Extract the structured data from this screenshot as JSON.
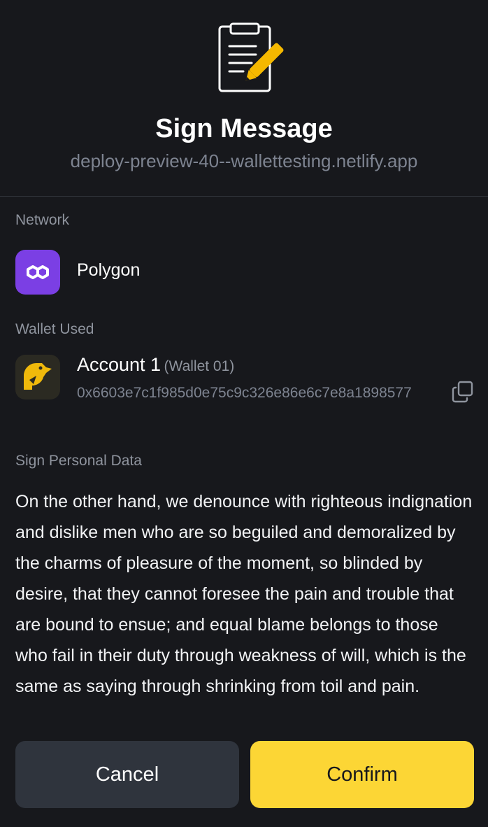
{
  "header": {
    "title": "Sign Message",
    "origin": "deploy-preview-40--wallettesting.netlify.app",
    "icon": "document-sign-icon"
  },
  "network": {
    "label": "Network",
    "name": "Polygon",
    "icon": "polygon-logo-icon",
    "color": "#7b3fe4"
  },
  "wallet": {
    "label": "Wallet Used",
    "account_name": "Account 1",
    "wallet_name": "(Wallet 01)",
    "address": "0x6603e7c1f985d0e75c9c326e86e6c7e8a1898577",
    "copy_icon": "copy-icon"
  },
  "sign": {
    "label": "Sign Personal Data",
    "message": "On the other hand, we denounce with righteous indignation and dislike men who are so beguiled and demoralized by the charms of pleasure of the moment, so blinded by desire, that they cannot foresee the pain and trouble that are bound to ensue; and equal blame belongs to those who fail in their duty through weakness of will, which is the same as saying through shrinking from toil and pain."
  },
  "actions": {
    "cancel_label": "Cancel",
    "confirm_label": "Confirm"
  },
  "colors": {
    "background": "#17181c",
    "accent": "#fcd635",
    "secondary_button": "#2f343d"
  }
}
